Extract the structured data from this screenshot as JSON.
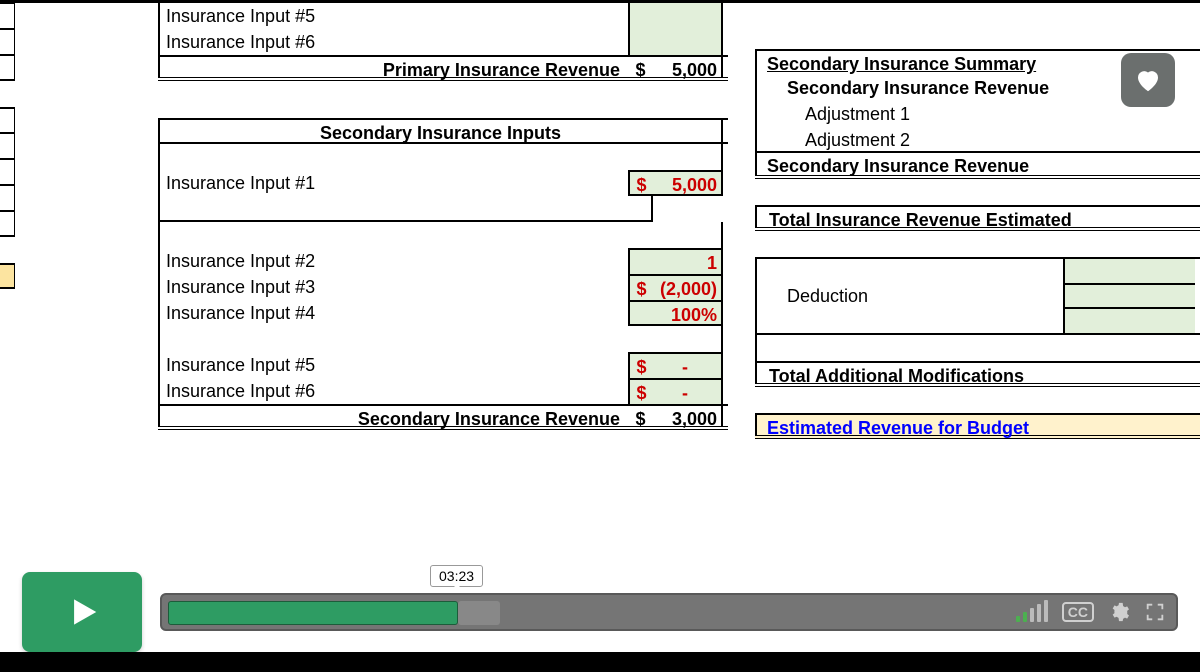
{
  "primary": {
    "inputs": [
      "Insurance Input #5",
      "Insurance Input #6"
    ],
    "revenue_label": "Primary Insurance Revenue",
    "revenue_dollar": "$",
    "revenue_value": "5,000"
  },
  "secondary": {
    "header": "Secondary Insurance Inputs",
    "rows": [
      {
        "label": "Insurance Input #1",
        "dollar": "$",
        "value": "5,000"
      },
      {
        "label": "Insurance Input #2",
        "dollar": "",
        "value": "1"
      },
      {
        "label": "Insurance Input #3",
        "dollar": "$",
        "value": "(2,000)"
      },
      {
        "label": "Insurance Input #4",
        "dollar": "",
        "value": "100%"
      },
      {
        "label": "Insurance Input #5",
        "dollar": "$",
        "value": "-"
      },
      {
        "label": "Insurance Input #6",
        "dollar": "$",
        "value": "-"
      }
    ],
    "revenue_label": "Secondary Insurance Revenue",
    "revenue_dollar": "$",
    "revenue_value": "3,000"
  },
  "summary": {
    "title": "Secondary Insurance Summary",
    "row1": "Secondary Insurance Revenue",
    "adj1": "Adjustment 1",
    "adj2": "Adjustment 2",
    "rev2": "Secondary Insurance Revenue",
    "total_est": "Total Insurance Revenue Estimated",
    "deduction": "Deduction",
    "total_mods": "Total Additional Modifications",
    "final": "Estimated Revenue for Budget"
  },
  "video": {
    "time_tooltip": "03:23",
    "cc": "CC"
  }
}
